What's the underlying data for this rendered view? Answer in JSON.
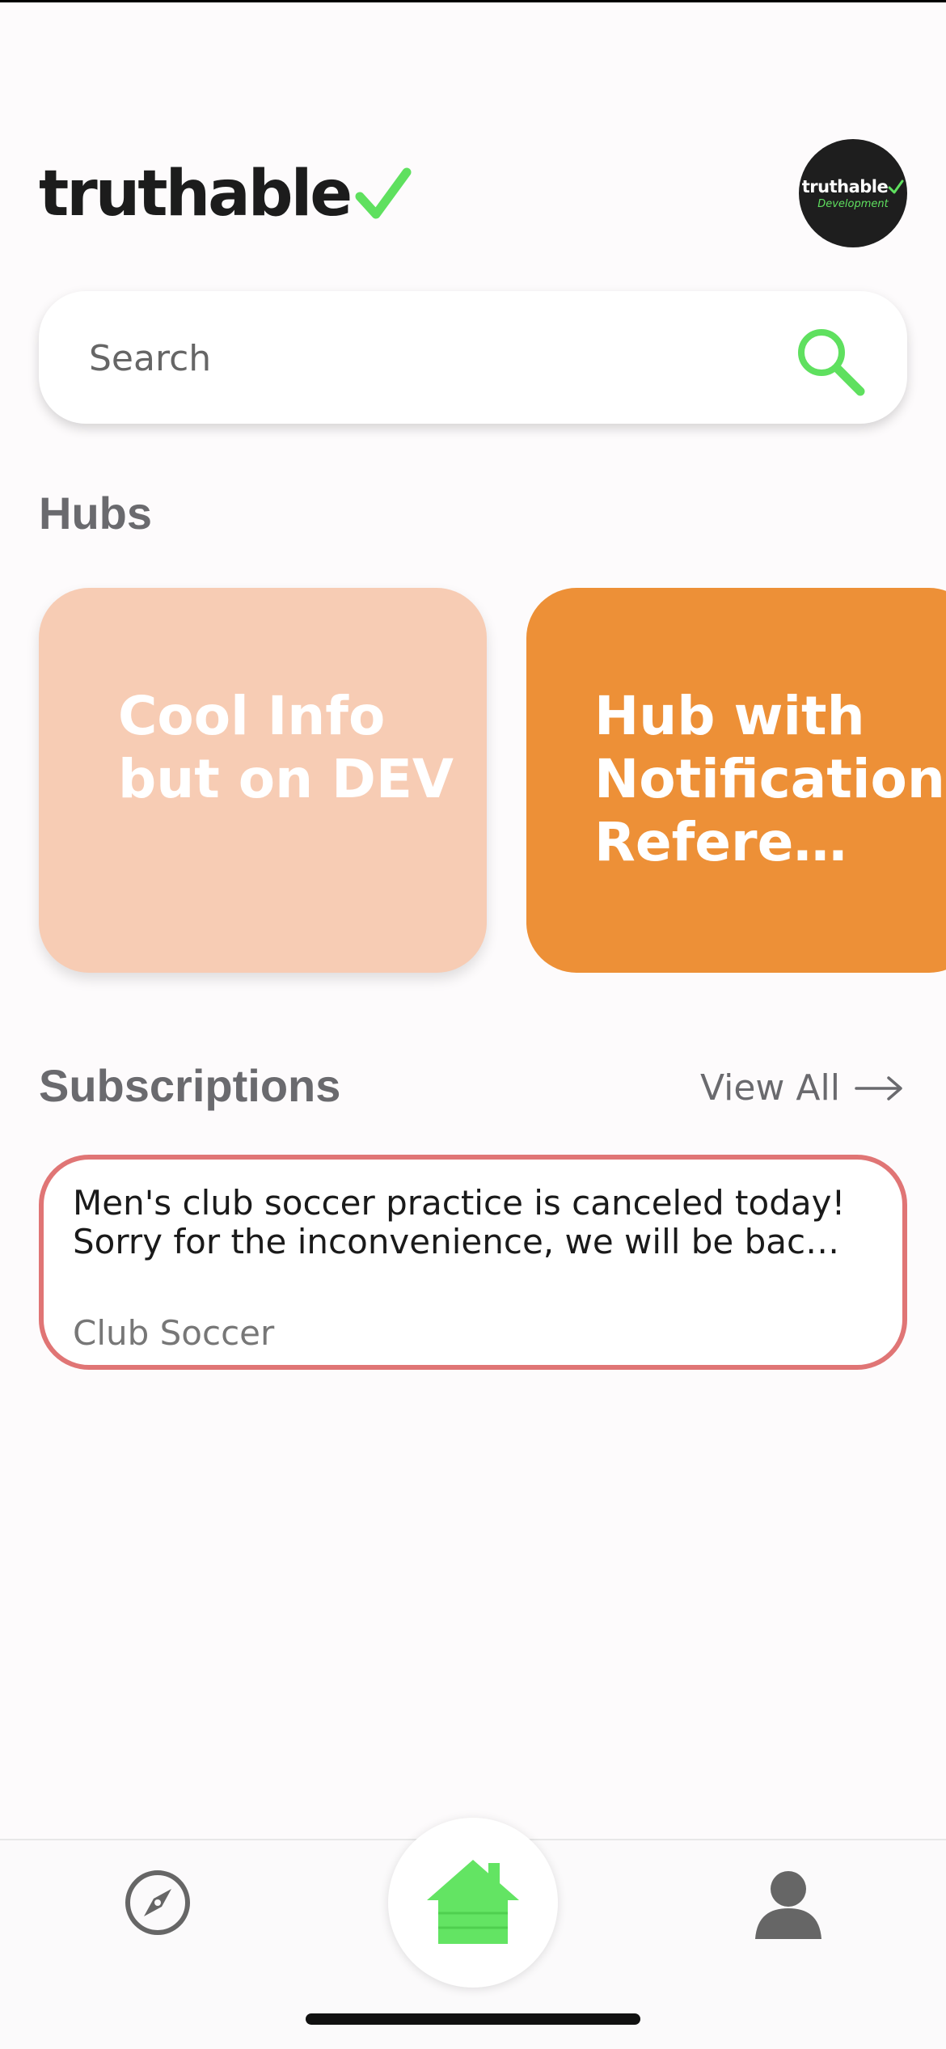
{
  "header": {
    "logo_text": "truthable",
    "avatar_title": "truthable",
    "avatar_subtitle": "Development"
  },
  "search": {
    "placeholder": "Search"
  },
  "hubs": {
    "title": "Hubs",
    "items": [
      {
        "label": "Cool Info but on DEV",
        "color": "#f7ccb4"
      },
      {
        "label": "Hub with Notification Refere…",
        "color": "#ed9037"
      }
    ]
  },
  "subscriptions": {
    "title": "Subscriptions",
    "view_all_label": "View All",
    "items": [
      {
        "message": "Men's club soccer practice is canceled today! Sorry for the inconvenience, we will be bac…",
        "source": "Club Soccer",
        "border_color": "#e07575"
      }
    ]
  },
  "nav": {
    "items": [
      {
        "icon": "compass-icon"
      },
      {
        "icon": "home-icon",
        "active": true,
        "color": "#63e463"
      },
      {
        "icon": "profile-icon"
      }
    ]
  },
  "colors": {
    "accent_green": "#5fe05f",
    "text_gray": "#6a6a6e"
  }
}
